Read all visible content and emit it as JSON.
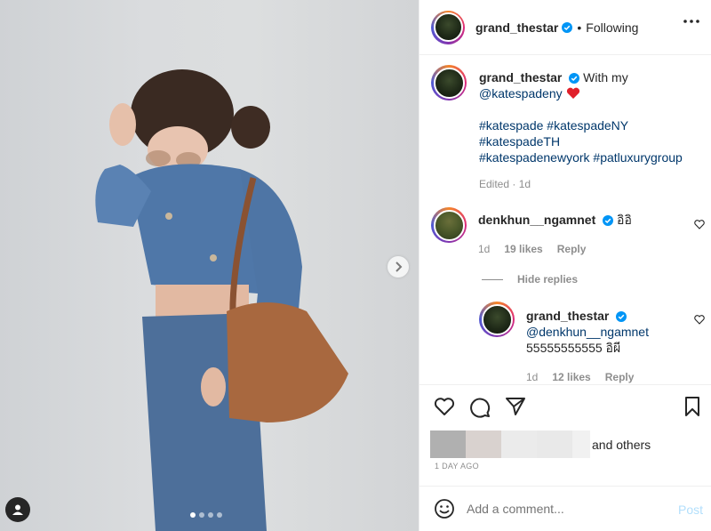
{
  "post": {
    "author": "grand_thestar",
    "follow_separator": "•",
    "follow_state": "Following",
    "image_dots": 4,
    "active_dot": 0
  },
  "caption": {
    "username": "grand_thestar",
    "text_prefix": "With my",
    "mention": "@katespadeny",
    "hashtags_line1": "#katespade #katespadeNY",
    "hashtags_line2": "#katespadeTH",
    "hashtags_line3": "#katespadenewyork #patluxurygroup",
    "meta": "Edited · 1d"
  },
  "comments": [
    {
      "username": "denkhun__ngamnet",
      "text": "อิอิ",
      "time": "1d",
      "likes": "19 likes",
      "reply_label": "Reply"
    }
  ],
  "hide_replies_label": "Hide replies",
  "reply": {
    "username": "grand_thestar",
    "mention": "@denkhun__ngamnet",
    "text": "55555555555 อิผี",
    "time": "1d",
    "likes": "12 likes",
    "reply_label": "Reply"
  },
  "likes_text": "and others",
  "date": "1 DAY AGO",
  "add_comment": {
    "placeholder": "Add a comment...",
    "post_label": "Post"
  },
  "colors": {
    "verified": "#0095f6",
    "link": "#00376b",
    "muted": "#8e8e8e",
    "post_disabled": "#b2dffc"
  }
}
